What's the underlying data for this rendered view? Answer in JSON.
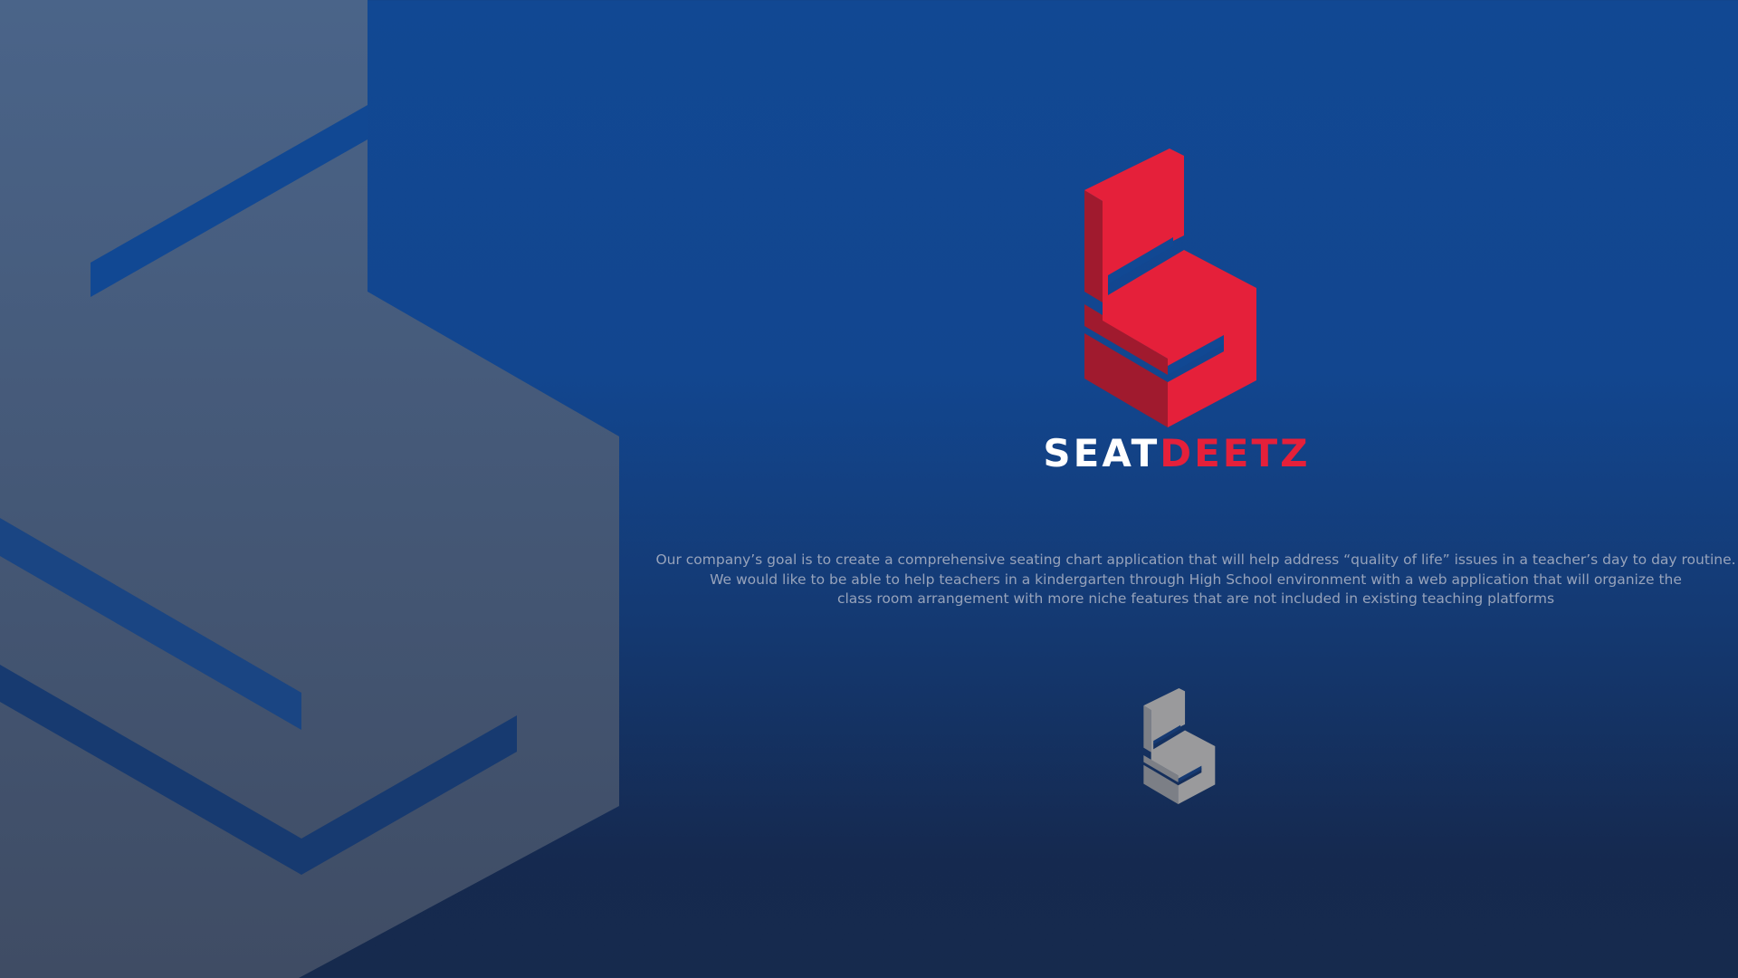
{
  "brand": {
    "name_part1": "SEAT",
    "name_part2": "DEETZ",
    "logo_icon": "chair-s-logo-icon",
    "primary_color": "#e5203a",
    "secondary_color": "#ffffff"
  },
  "mission": {
    "line1": "Our company’s goal is to create a comprehensive seating chart application that will help address “quality of life” issues in a teacher’s day to day routine.",
    "line2": "We would like to be able to help teachers in a kindergarten through High School environment with a web application that will organize the",
    "line3": "class room arrangement with more niche features that are not included in existing teaching platforms"
  },
  "background": {
    "gradient_top": "#114893",
    "gradient_bottom": "#162a4d",
    "watermark_color": "#3f5a80"
  }
}
